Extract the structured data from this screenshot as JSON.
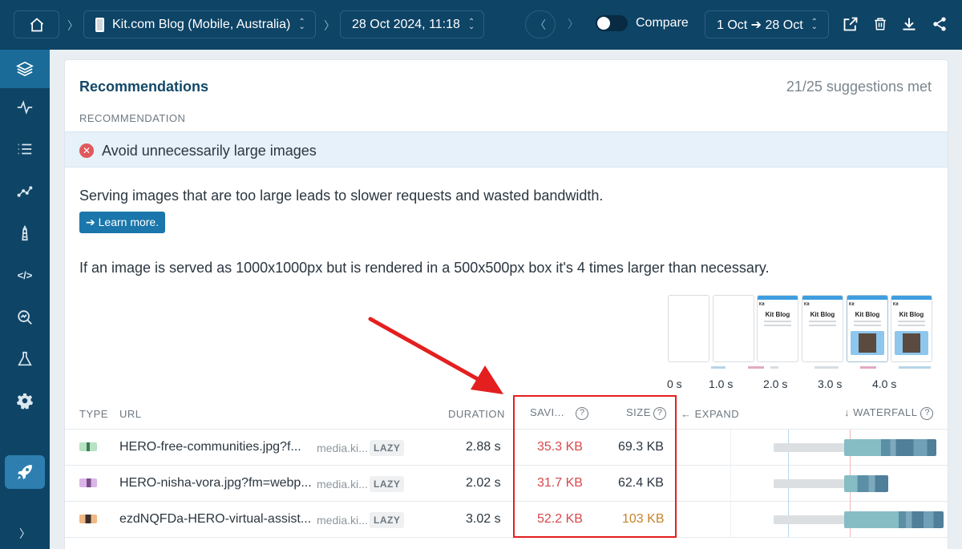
{
  "topbar": {
    "page_name": "Kit.com Blog (Mobile, Australia)",
    "test_date": "28 Oct 2024, 11:18",
    "compare_label": "Compare",
    "date_range": "1 Oct ➔ 28 Oct"
  },
  "panel": {
    "title": "Recommendations",
    "suggestions_met": "21/25 suggestions met",
    "recommendation_header": "RECOMMENDATION",
    "recommendation_title": "Avoid unnecessarily large images",
    "description": "Serving images that are too large leads to slower requests and wasted bandwidth.",
    "learn_more": "➔ Learn more.",
    "explanation": "If an image is served as 1000x1000px but is rendered in a 500x500px box it's 4 times larger than necessary."
  },
  "filmstrip": {
    "kit_label": "Kit",
    "blog_label": "Kit Blog",
    "timeline_labels": [
      "0 s",
      "1.0 s",
      "2.0 s",
      "3.0 s",
      "4.0 s"
    ]
  },
  "table": {
    "headers": {
      "type": "TYPE",
      "url": "URL",
      "duration": "DURATION",
      "savings": "SAVI...",
      "size": "SIZE",
      "expand": "← EXPAND",
      "waterfall": "↓ WATERFALL"
    },
    "rows": [
      {
        "url": "HERO-free-communities.jpg?f...",
        "domain": "media.ki...",
        "badge": "LAZY",
        "duration": "2.88 s",
        "savings": "35.3 KB",
        "size": "69.3 KB"
      },
      {
        "url": "HERO-nisha-vora.jpg?fm=webp...",
        "domain": "media.ki...",
        "badge": "LAZY",
        "duration": "2.02 s",
        "savings": "31.7 KB",
        "size": "62.4 KB"
      },
      {
        "url": "ezdNQFDa-HERO-virtual-assist...",
        "domain": "media.ki...",
        "badge": "LAZY",
        "duration": "3.02 s",
        "savings": "52.2 KB",
        "size": "103 KB"
      }
    ]
  },
  "colors": {
    "topbar_bg": "#0e4466",
    "accent_blue": "#1a76ab",
    "error_red": "#d9484d",
    "warning_orange": "#c7832a",
    "annotation_red": "#e41f1f"
  }
}
